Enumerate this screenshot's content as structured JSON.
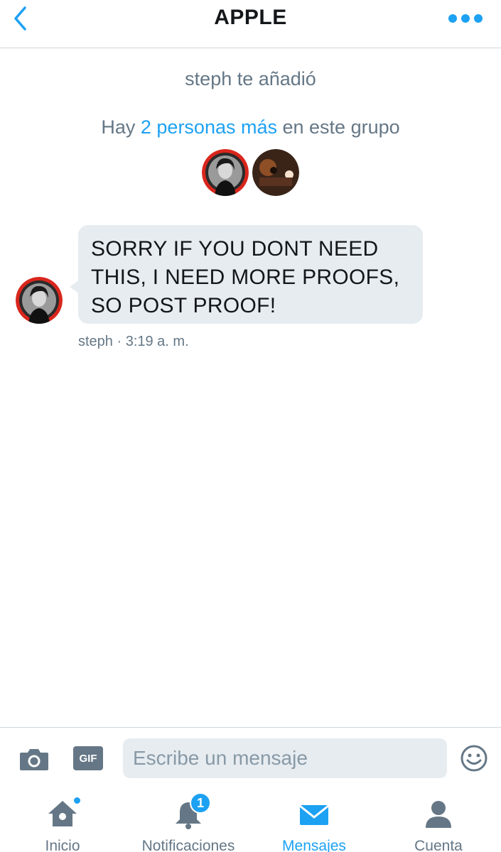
{
  "header": {
    "title": "APPLE",
    "back_icon": "chevron-left-icon",
    "more_icon": "more-dots-icon",
    "accent": "#1da1f2"
  },
  "conversation": {
    "added_note": "steph te añadió",
    "group_note_prefix": "Hay ",
    "group_note_link": "2 personas más",
    "group_note_suffix": " en este grupo",
    "participants": [
      "avatar-steph",
      "avatar-concert"
    ]
  },
  "messages": [
    {
      "sender": "steph",
      "text": "SORRY IF YOU DONT NEED THIS, I NEED MORE PROOFS, SO POST PROOF!",
      "meta": "steph · 3:19 a. m."
    }
  ],
  "composer": {
    "placeholder": "Escribe un mensaje",
    "gif_label": "GIF",
    "camera_icon": "camera-icon",
    "emoji_icon": "emoji-icon"
  },
  "tabbar": {
    "tabs": [
      {
        "label": "Inicio",
        "icon": "home-icon",
        "badge_dot": true
      },
      {
        "label": "Notificaciones",
        "icon": "bell-icon",
        "badge_count": "1"
      },
      {
        "label": "Mensajes",
        "icon": "envelope-icon",
        "active": true
      },
      {
        "label": "Cuenta",
        "icon": "person-icon"
      }
    ]
  }
}
